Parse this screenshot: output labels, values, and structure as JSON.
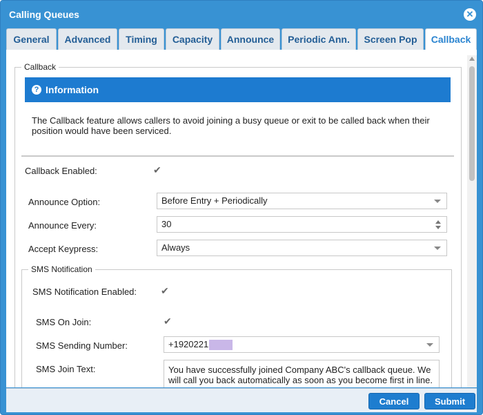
{
  "window": {
    "title": "Calling Queues",
    "close_icon": "close-icon"
  },
  "tabs": [
    {
      "label": "General"
    },
    {
      "label": "Advanced"
    },
    {
      "label": "Timing"
    },
    {
      "label": "Capacity"
    },
    {
      "label": "Announce"
    },
    {
      "label": "Periodic Ann."
    },
    {
      "label": "Screen Pop"
    },
    {
      "label": "Callback",
      "active": true
    }
  ],
  "callback": {
    "legend": "Callback",
    "info_title": "Information",
    "info_text": "The Callback feature allows callers to avoid joining a busy queue or exit to be called back when their position would have been serviced.",
    "enabled_label": "Callback Enabled:",
    "enabled": true,
    "announce_option_label": "Announce Option:",
    "announce_option_value": "Before Entry + Periodically",
    "announce_every_label": "Announce Every:",
    "announce_every_value": "30",
    "accept_keypress_label": "Accept Keypress:",
    "accept_keypress_value": "Always"
  },
  "sms": {
    "legend": "SMS Notification",
    "enabled_label": "SMS Notification Enabled:",
    "enabled": true,
    "on_join_label": "SMS On Join:",
    "on_join": true,
    "sending_number_label": "SMS Sending Number:",
    "sending_number_value": "+1920221",
    "join_text_label": "SMS Join Text:",
    "join_text_value": "You have successfully joined Company ABC's callback queue. We will call you back automatically as soon as you become first in line."
  },
  "footer": {
    "cancel_label": "Cancel",
    "submit_label": "Submit"
  },
  "colors": {
    "accent": "#3892d3",
    "button": "#1e7dcf",
    "info_header": "#1d7bd0"
  }
}
